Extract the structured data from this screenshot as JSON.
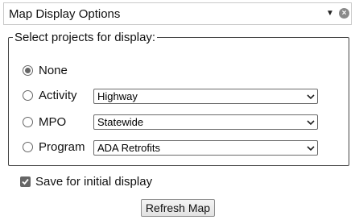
{
  "header": {
    "title": "Map Display Options",
    "chevron_icon": "chevron-down-icon",
    "close_icon": "close-circle-icon"
  },
  "group": {
    "legend": "Select projects for display:",
    "options": [
      {
        "label": "None",
        "checked": true
      },
      {
        "label": "Activity",
        "checked": false,
        "select_value": "Highway"
      },
      {
        "label": "MPO",
        "checked": false,
        "select_value": "Statewide"
      },
      {
        "label": "Program",
        "checked": false,
        "select_value": "ADA Retrofits"
      }
    ]
  },
  "save_option": {
    "label": "Save for initial display",
    "checked": true
  },
  "refresh_button": {
    "label": "Refresh Map"
  },
  "colors": {
    "control_gray": "#666666",
    "border_gray": "#c9c9c9",
    "close_gray": "#8a8a8a"
  }
}
